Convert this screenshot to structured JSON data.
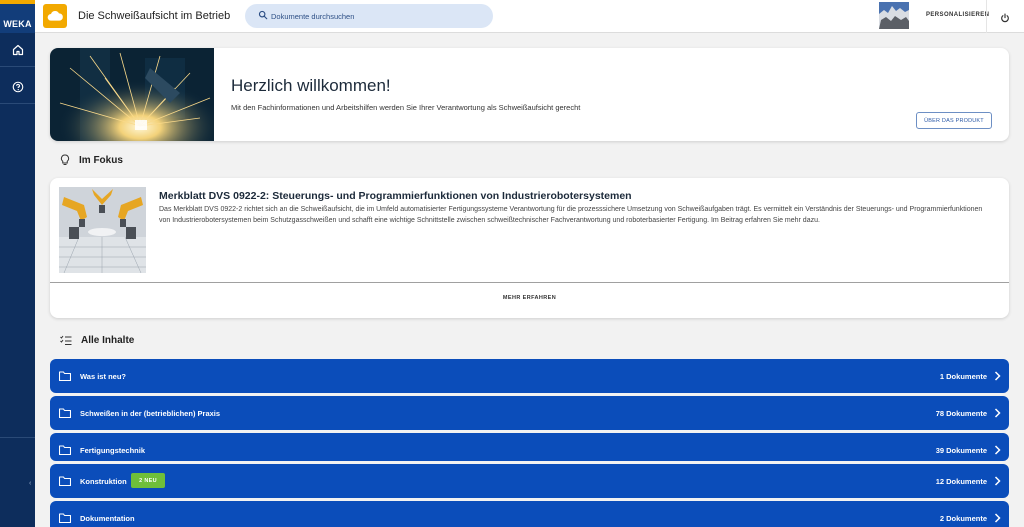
{
  "brand": {
    "name": "WEKA"
  },
  "app": {
    "title": "Die Schweißaufsicht im Betrieb"
  },
  "search": {
    "placeholder": "Dokumente durchsuchen"
  },
  "header": {
    "personalize_label": "PERSONALISIEREN"
  },
  "welcome": {
    "title": "Herzlich willkommen!",
    "subtitle": "Mit den Fachinformationen und Arbeitshilfen werden Sie Ihrer Verantwortung als Schweißaufsicht gerecht",
    "product_button": "ÜBER DAS PRODUKT"
  },
  "fokus": {
    "section_title": "Im Fokus",
    "title": "Merkblatt DVS 0922-2: Steuerungs- und Programmierfunktionen von Industrierobotersystemen",
    "text": "Das Merkblatt DVS 0922-2 richtet sich an die Schweißaufsicht, die im Umfeld automatisierter Fertigungssysteme Verantwortung für die prozesssichere Umsetzung von Schweißaufgaben trägt. Es vermittelt ein Verständnis der Steuerungs- und Programmierfunktionen von Industrierobotersystemen beim Schutzgasschweißen und schafft eine wichtige Schnittstelle zwischen schweißtechnischer Fachverantwortung und roboterbasierter Fertigung. Im Beitrag erfahren Sie mehr dazu.",
    "more_label": "MEHR ERFAHREN"
  },
  "content": {
    "section_title": "Alle Inhalte",
    "rows": [
      {
        "label": "Was ist neu?",
        "count": "1 Dokumente"
      },
      {
        "label": "Schweißen in der (betrieblichen) Praxis",
        "count": "78 Dokumente"
      },
      {
        "label": "Fertigungstechnik",
        "count": "39 Dokumente"
      },
      {
        "label": "Konstruktion",
        "count": "12 Dokumente",
        "badge": "2 NEU"
      },
      {
        "label": "Dokumentation",
        "count": "2 Dokumente"
      }
    ]
  },
  "colors": {
    "accent": "#0b4dba",
    "brand": "#f2a900",
    "nav": "#0d2d5c",
    "badge": "#6fbf3a"
  }
}
